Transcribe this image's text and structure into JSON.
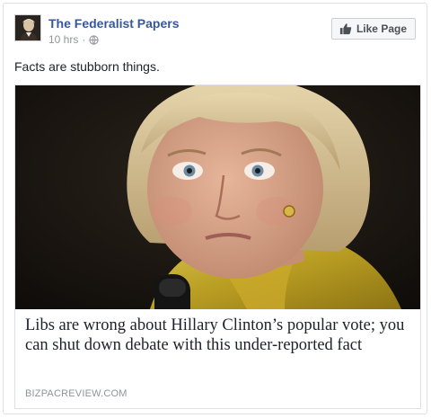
{
  "post": {
    "page_name": "The Federalist Papers",
    "time": "10 hrs",
    "separator": "·",
    "privacy_icon": "globe-icon",
    "like_button_label": "Like Page",
    "like_button_icon": "thumbs-up-icon",
    "text": "Facts are stubborn things."
  },
  "link": {
    "title": "Libs are wrong about Hillary Clinton’s popular vote; you can shut down debate with this under-reported fact",
    "domain": "BIZPACREVIEW.COM"
  },
  "colors": {
    "page_name": "#365899",
    "meta": "#90949c",
    "card_border": "#dddfe2"
  }
}
